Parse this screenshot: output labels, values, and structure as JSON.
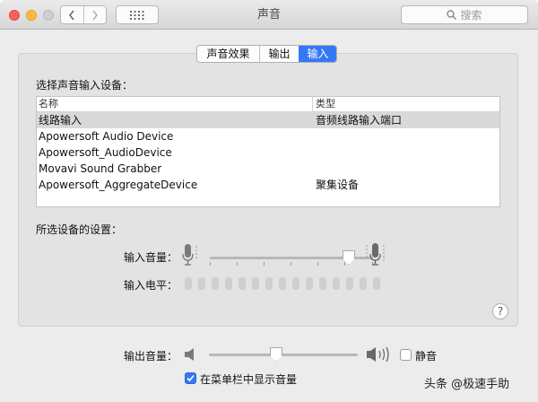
{
  "window": {
    "title": "声音",
    "search_placeholder": "搜索"
  },
  "tabs": [
    {
      "label": "声音效果",
      "selected": false
    },
    {
      "label": "输出",
      "selected": false
    },
    {
      "label": "输入",
      "selected": true
    }
  ],
  "input": {
    "select_label": "选择声音输入设备：",
    "columns": {
      "name": "名称",
      "type": "类型"
    },
    "devices": [
      {
        "name": "线路输入",
        "type": "音频线路输入端口",
        "selected": true
      },
      {
        "name": "Apowersoft Audio Device",
        "type": ""
      },
      {
        "name": "Apowersoft_AudioDevice",
        "type": ""
      },
      {
        "name": "Movavi Sound Grabber",
        "type": ""
      },
      {
        "name": "Apowersoft_AggregateDevice",
        "type": "聚集设备"
      }
    ],
    "settings_label": "所选设备的设置：",
    "volume_label": "输入音量：",
    "volume_level": 0.85,
    "level_label": "输入电平："
  },
  "output": {
    "volume_label": "输出音量：",
    "volume_level": 0.45,
    "mute_label": "静音",
    "mute_checked": false,
    "show_in_menubar_label": "在菜单栏中显示音量",
    "show_in_menubar_checked": true
  },
  "help_label": "?",
  "watermark": "头条 @极速手助",
  "colors": {
    "accent": "#3478f6",
    "window_bg": "#ececec"
  },
  "icons": [
    "back-chevron-icon",
    "forward-chevron-icon",
    "grid-icon",
    "search-icon",
    "microphone-low-icon",
    "microphone-high-icon",
    "speaker-low-icon",
    "speaker-high-icon",
    "help-icon",
    "checkmark-icon"
  ]
}
